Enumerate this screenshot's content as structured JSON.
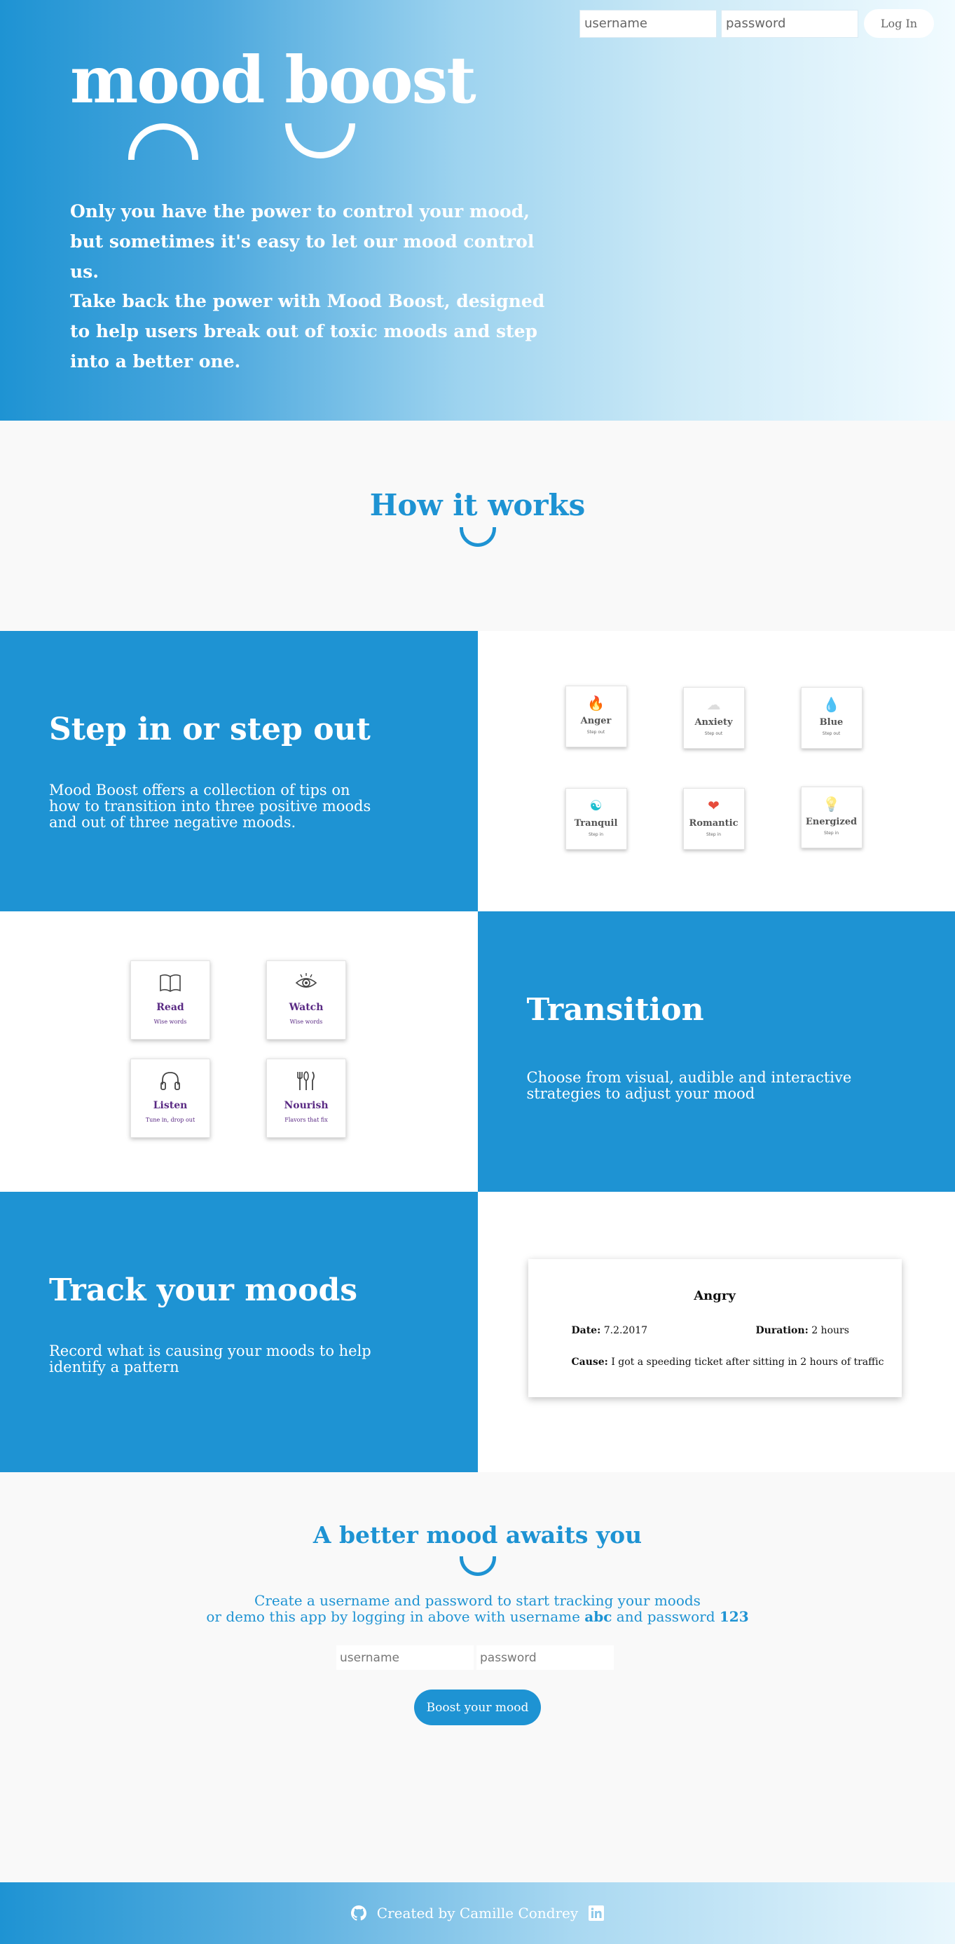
{
  "header": {
    "username_placeholder": "username",
    "password_placeholder": "password",
    "login_label": "Log In"
  },
  "hero": {
    "title": "mood boost",
    "paragraph1": "Only you have the power to control your mood, but sometimes it's easy to let our mood control us.",
    "paragraph2": "Take back the power with Mood Boost, designed to help users break out of toxic moods and step into a better one."
  },
  "how": {
    "heading": "How it works"
  },
  "step": {
    "title": "Step in or step out",
    "text": "Mood Boost offers a collection of tips on how to transition into three positive moods and out of three negative moods.",
    "moods": [
      {
        "name": "Anger",
        "sub": "Step out",
        "icon": "flame-icon",
        "glyph": "🔥"
      },
      {
        "name": "Anxiety",
        "sub": "Step out",
        "icon": "cloud-icon",
        "glyph": "☁"
      },
      {
        "name": "Blue",
        "sub": "Step out",
        "icon": "droplet-icon",
        "glyph": "💧"
      },
      {
        "name": "Tranquil",
        "sub": "Step in",
        "icon": "yin-yang-icon",
        "glyph": "☯"
      },
      {
        "name": "Romantic",
        "sub": "Step in",
        "icon": "heart-icon",
        "glyph": "❤"
      },
      {
        "name": "Energized",
        "sub": "Step in",
        "icon": "lightbulb-icon",
        "glyph": "💡"
      }
    ]
  },
  "transition": {
    "title": "Transition",
    "text": "Choose from visual, audible and interactive strategies to adjust your mood",
    "strategies": [
      {
        "name": "Read",
        "sub": "Wise words",
        "icon": "book-icon"
      },
      {
        "name": "Watch",
        "sub": "Wise words",
        "icon": "eye-icon"
      },
      {
        "name": "Listen",
        "sub": "Tune in, drop out",
        "icon": "headphones-icon"
      },
      {
        "name": "Nourish",
        "sub": "Flavors that fix",
        "icon": "utensils-icon"
      }
    ]
  },
  "track": {
    "title": "Track your moods",
    "text": "Record what is causing your moods to help identify a pattern",
    "entry": {
      "mood": "Angry",
      "date_label": "Date:",
      "date_value": "7.2.2017",
      "duration_label": "Duration:",
      "duration_value": "2 hours",
      "cause_label": "Cause:",
      "cause_value": "I got a speeding ticket after sitting in 2 hours of traffic"
    }
  },
  "signup": {
    "heading": "A better mood awaits you",
    "line1": "Create a username and password to start tracking your moods",
    "line2_a": "or demo this app by logging in above with username ",
    "line2_user": "abc",
    "line2_b": " and password ",
    "line2_pass": "123",
    "username_placeholder": "username",
    "password_placeholder": "password",
    "button_label": "Boost your mood"
  },
  "footer": {
    "text": "Created by Camille Condrey",
    "icons": [
      "github-icon",
      "linkedin-icon"
    ]
  },
  "colors": {
    "primary": "#1e93d3",
    "accent_purple": "#5a2a84",
    "background": "#f9f9f9"
  }
}
